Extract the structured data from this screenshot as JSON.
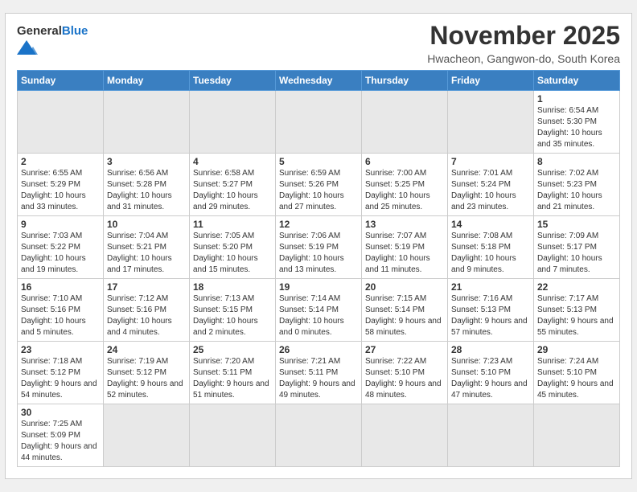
{
  "header": {
    "logo_general": "General",
    "logo_blue": "Blue",
    "month": "November 2025",
    "location": "Hwacheon, Gangwon-do, South Korea"
  },
  "days_of_week": [
    "Sunday",
    "Monday",
    "Tuesday",
    "Wednesday",
    "Thursday",
    "Friday",
    "Saturday"
  ],
  "weeks": [
    [
      {
        "day": "",
        "empty": true
      },
      {
        "day": "",
        "empty": true
      },
      {
        "day": "",
        "empty": true
      },
      {
        "day": "",
        "empty": true
      },
      {
        "day": "",
        "empty": true
      },
      {
        "day": "",
        "empty": true
      },
      {
        "day": "1",
        "sunrise": "6:54 AM",
        "sunset": "5:30 PM",
        "daylight": "10 hours and 35 minutes."
      }
    ],
    [
      {
        "day": "2",
        "sunrise": "6:55 AM",
        "sunset": "5:29 PM",
        "daylight": "10 hours and 33 minutes."
      },
      {
        "day": "3",
        "sunrise": "6:56 AM",
        "sunset": "5:28 PM",
        "daylight": "10 hours and 31 minutes."
      },
      {
        "day": "4",
        "sunrise": "6:58 AM",
        "sunset": "5:27 PM",
        "daylight": "10 hours and 29 minutes."
      },
      {
        "day": "5",
        "sunrise": "6:59 AM",
        "sunset": "5:26 PM",
        "daylight": "10 hours and 27 minutes."
      },
      {
        "day": "6",
        "sunrise": "7:00 AM",
        "sunset": "5:25 PM",
        "daylight": "10 hours and 25 minutes."
      },
      {
        "day": "7",
        "sunrise": "7:01 AM",
        "sunset": "5:24 PM",
        "daylight": "10 hours and 23 minutes."
      },
      {
        "day": "8",
        "sunrise": "7:02 AM",
        "sunset": "5:23 PM",
        "daylight": "10 hours and 21 minutes."
      }
    ],
    [
      {
        "day": "9",
        "sunrise": "7:03 AM",
        "sunset": "5:22 PM",
        "daylight": "10 hours and 19 minutes."
      },
      {
        "day": "10",
        "sunrise": "7:04 AM",
        "sunset": "5:21 PM",
        "daylight": "10 hours and 17 minutes."
      },
      {
        "day": "11",
        "sunrise": "7:05 AM",
        "sunset": "5:20 PM",
        "daylight": "10 hours and 15 minutes."
      },
      {
        "day": "12",
        "sunrise": "7:06 AM",
        "sunset": "5:19 PM",
        "daylight": "10 hours and 13 minutes."
      },
      {
        "day": "13",
        "sunrise": "7:07 AM",
        "sunset": "5:19 PM",
        "daylight": "10 hours and 11 minutes."
      },
      {
        "day": "14",
        "sunrise": "7:08 AM",
        "sunset": "5:18 PM",
        "daylight": "10 hours and 9 minutes."
      },
      {
        "day": "15",
        "sunrise": "7:09 AM",
        "sunset": "5:17 PM",
        "daylight": "10 hours and 7 minutes."
      }
    ],
    [
      {
        "day": "16",
        "sunrise": "7:10 AM",
        "sunset": "5:16 PM",
        "daylight": "10 hours and 5 minutes."
      },
      {
        "day": "17",
        "sunrise": "7:12 AM",
        "sunset": "5:16 PM",
        "daylight": "10 hours and 4 minutes."
      },
      {
        "day": "18",
        "sunrise": "7:13 AM",
        "sunset": "5:15 PM",
        "daylight": "10 hours and 2 minutes."
      },
      {
        "day": "19",
        "sunrise": "7:14 AM",
        "sunset": "5:14 PM",
        "daylight": "10 hours and 0 minutes."
      },
      {
        "day": "20",
        "sunrise": "7:15 AM",
        "sunset": "5:14 PM",
        "daylight": "9 hours and 58 minutes."
      },
      {
        "day": "21",
        "sunrise": "7:16 AM",
        "sunset": "5:13 PM",
        "daylight": "9 hours and 57 minutes."
      },
      {
        "day": "22",
        "sunrise": "7:17 AM",
        "sunset": "5:13 PM",
        "daylight": "9 hours and 55 minutes."
      }
    ],
    [
      {
        "day": "23",
        "sunrise": "7:18 AM",
        "sunset": "5:12 PM",
        "daylight": "9 hours and 54 minutes."
      },
      {
        "day": "24",
        "sunrise": "7:19 AM",
        "sunset": "5:12 PM",
        "daylight": "9 hours and 52 minutes."
      },
      {
        "day": "25",
        "sunrise": "7:20 AM",
        "sunset": "5:11 PM",
        "daylight": "9 hours and 51 minutes."
      },
      {
        "day": "26",
        "sunrise": "7:21 AM",
        "sunset": "5:11 PM",
        "daylight": "9 hours and 49 minutes."
      },
      {
        "day": "27",
        "sunrise": "7:22 AM",
        "sunset": "5:10 PM",
        "daylight": "9 hours and 48 minutes."
      },
      {
        "day": "28",
        "sunrise": "7:23 AM",
        "sunset": "5:10 PM",
        "daylight": "9 hours and 47 minutes."
      },
      {
        "day": "29",
        "sunrise": "7:24 AM",
        "sunset": "5:10 PM",
        "daylight": "9 hours and 45 minutes."
      }
    ],
    [
      {
        "day": "30",
        "sunrise": "7:25 AM",
        "sunset": "5:09 PM",
        "daylight": "9 hours and 44 minutes."
      },
      {
        "day": "",
        "empty": true
      },
      {
        "day": "",
        "empty": true
      },
      {
        "day": "",
        "empty": true
      },
      {
        "day": "",
        "empty": true
      },
      {
        "day": "",
        "empty": true
      },
      {
        "day": "",
        "empty": true
      }
    ]
  ]
}
